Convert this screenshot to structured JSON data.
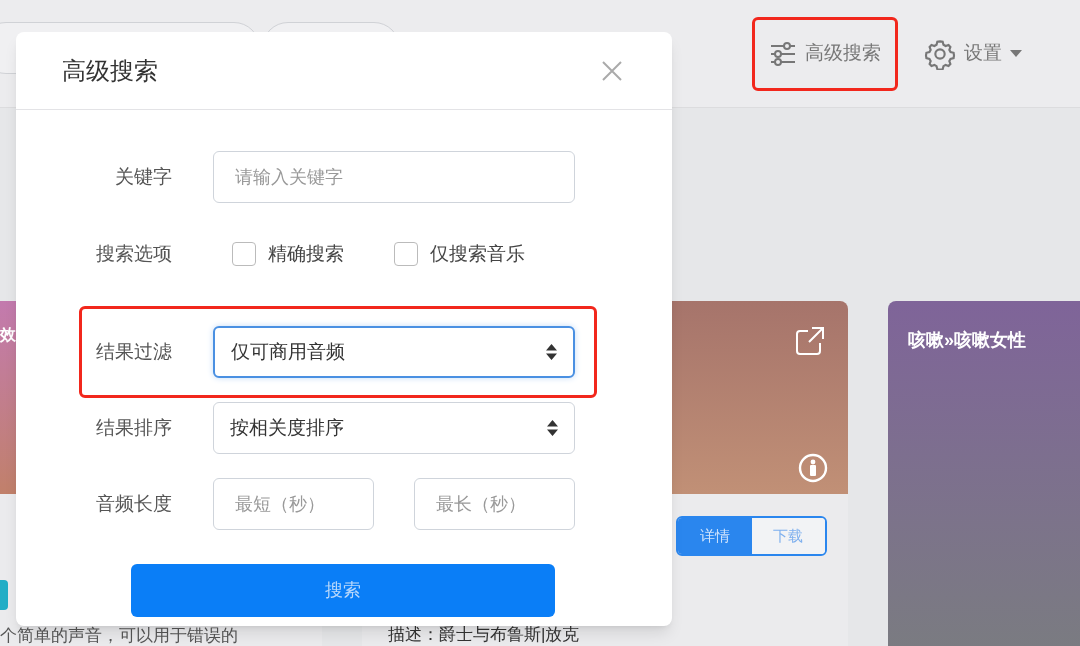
{
  "header": {
    "advanced_search": {
      "label": "高级搜索",
      "highlighted": true
    },
    "settings": "设置"
  },
  "cards": [
    {
      "title": "效",
      "description": "个简单的声音，可以用于错误的"
    },
    {
      "actions": [
        {
          "label": "详情",
          "selected": true
        },
        {
          "label": "下载",
          "selected": false
        }
      ],
      "description": "描述：爵士与布鲁斯|放克"
    },
    {
      "title": "咳嗽»咳嗽女性"
    }
  ],
  "dialog": {
    "title": "高级搜索",
    "keyword": {
      "label": "关键字",
      "placeholder": "请输入关键字"
    },
    "options": {
      "label": "搜索选项",
      "items": [
        {
          "label": "精确搜索",
          "checked": false
        },
        {
          "label": "仅搜索音乐",
          "checked": false
        }
      ]
    },
    "filter": {
      "label": "结果过滤",
      "value": "仅可商用音频",
      "focused": true,
      "highlighted": true
    },
    "sort": {
      "label": "结果排序",
      "value": "按相关度排序",
      "focused": false
    },
    "duration": {
      "label": "音频长度",
      "min_placeholder": "最短（秒）",
      "max_placeholder": "最长（秒）"
    },
    "submit": "搜索"
  }
}
